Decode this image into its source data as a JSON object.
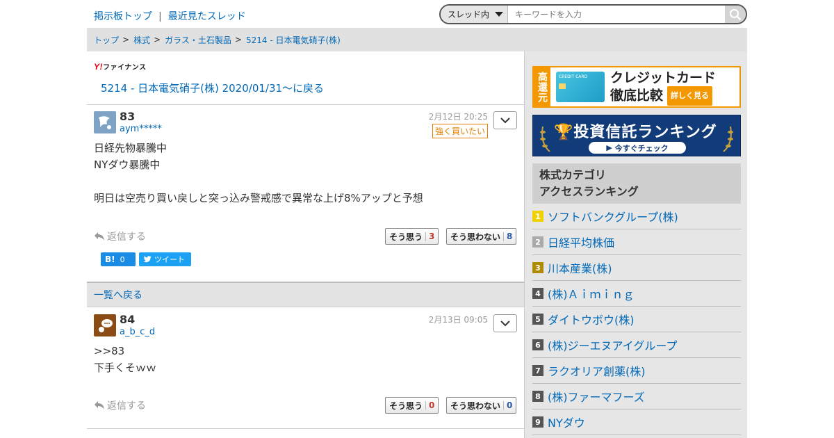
{
  "topnav": {
    "board_top": "掲示板トップ",
    "separator": "|",
    "recent": "最近見たスレッド"
  },
  "search": {
    "scope": "スレッド内",
    "placeholder": "キーワードを入力"
  },
  "breadcrumb": {
    "items": [
      "トップ",
      "株式",
      "ガラス・土石製品",
      "5214 - 日本電気硝子(株)"
    ],
    "sep": ">"
  },
  "logo": {
    "y": "Y!",
    "text": "ファイナンス"
  },
  "back_link": "5214 - 日本電気硝子(株) 2020/01/31〜に戻る",
  "posts": [
    {
      "number": "83",
      "user": "aym*****",
      "time": "2月12日 20:25",
      "badge": "強く買いたい",
      "body": "日経先物暴騰中\nNYダウ暴騰中\n\n明日は空売り買い戻しと突っ込み警戒感で異常な上げ8%アップと予想",
      "reply": "返信する",
      "agree_label": "そう思う",
      "agree_count": "3",
      "disagree_label": "そう思わない",
      "disagree_count": "8"
    },
    {
      "number": "84",
      "user": "a_b_c_d",
      "time": "2月13日 09:05",
      "body": ">>83\n下手くそｗｗ",
      "reply": "返信する",
      "agree_label": "そう思う",
      "agree_count": "0",
      "disagree_label": "そう思わない",
      "disagree_count": "0"
    }
  ],
  "share": {
    "hatena_label": "B!",
    "hatena_count": "0",
    "tweet": "ツイート"
  },
  "list_back": "一覧へ戻る",
  "ads": {
    "card": {
      "side": "高還元",
      "card_label": "CREDIT CARD",
      "line1": "クレジットカード",
      "line2": "徹底比較",
      "more": "詳しく見る"
    },
    "fund": {
      "title": "投資信託ランキング",
      "cta": "今すぐチェック"
    }
  },
  "ranking": {
    "heading_line1": "株式カテゴリ",
    "heading_line2": "アクセスランキング",
    "items": [
      {
        "rank": "1",
        "name": "ソフトバンクグループ(株)"
      },
      {
        "rank": "2",
        "name": "日経平均株価"
      },
      {
        "rank": "3",
        "name": "川本産業(株)"
      },
      {
        "rank": "4",
        "name": "(株)Ａｉｍｉｎｇ"
      },
      {
        "rank": "5",
        "name": "ダイトウボウ(株)"
      },
      {
        "rank": "6",
        "name": "(株)ジーエヌアイグループ"
      },
      {
        "rank": "7",
        "name": "ラクオリア創薬(株)"
      },
      {
        "rank": "8",
        "name": "(株)ファーマフーズ"
      },
      {
        "rank": "9",
        "name": "NYダウ"
      }
    ]
  },
  "colors": {
    "link": "#0068b7",
    "gold": "#f0d000",
    "silver": "#aaaaaa",
    "bronze": "#b08a00",
    "rank_default": "#555555",
    "badge": "#e67e00"
  }
}
